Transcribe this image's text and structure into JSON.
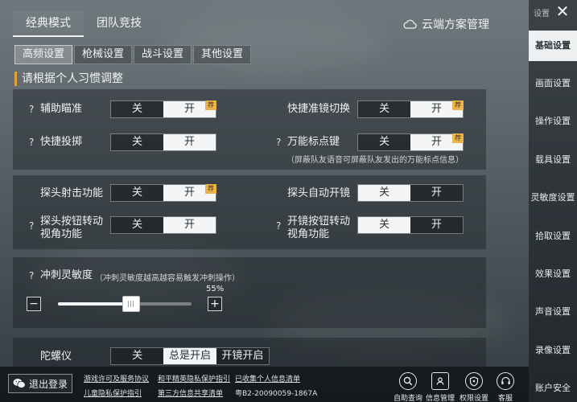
{
  "top_tabs": [
    {
      "label": "经典模式",
      "active": true
    },
    {
      "label": "团队竞技",
      "active": false
    }
  ],
  "cloud_manage": "云端方案管理",
  "sub_tabs": [
    {
      "label": "高频设置",
      "active": true
    },
    {
      "label": "枪械设置",
      "active": false
    },
    {
      "label": "战斗设置",
      "active": false
    },
    {
      "label": "其他设置",
      "active": false
    }
  ],
  "section_heading": "请根据个人习惯调整",
  "help_mark": "?",
  "toggle_off": "关",
  "toggle_on": "开",
  "badge_text": "荐",
  "panel1": {
    "aim_assist": {
      "label": "辅助瞄准",
      "selected": "on",
      "recommended": true
    },
    "quick_scope_switch": {
      "label": "快捷准镜切换",
      "selected": "on",
      "recommended": true
    },
    "quick_throw": {
      "label": "快捷投掷",
      "selected": "on",
      "recommended": false
    },
    "universal_marker": {
      "label": "万能标点键",
      "selected": "on",
      "recommended": true,
      "note": "（屏蔽队友语音可屏蔽队友发出的万能标点信息）"
    }
  },
  "panel2": {
    "peek_fire": {
      "label": "探头射击功能",
      "selected": "on",
      "recommended": true
    },
    "peek_auto_scope": {
      "label": "探头自动开镜",
      "selected": "off",
      "recommended": false
    },
    "peek_button_rotate": {
      "label_line1": "探头按钮转动",
      "label_line2": "视角功能",
      "selected": "on",
      "recommended": false
    },
    "scope_button_rotate": {
      "label_line1": "开镜按钮转动",
      "label_line2": "视角功能",
      "selected": "off",
      "recommended": false
    }
  },
  "panel3": {
    "label": "冲刺灵敏度",
    "note": "（冲刺灵敏度越高越容易触发冲刺操作）",
    "value": 0.55,
    "value_text": "55%",
    "minus": "−",
    "plus": "+"
  },
  "panel4": {
    "label": "陀螺仪",
    "options": [
      "关",
      "总是开启",
      "开镜开启"
    ],
    "selected_index": 1
  },
  "sidebar": {
    "title": "设置",
    "close": "✕",
    "items": [
      {
        "label": "基础设置",
        "active": true
      },
      {
        "label": "画面设置",
        "active": false
      },
      {
        "label": "操作设置",
        "active": false
      },
      {
        "label": "载具设置",
        "active": false
      },
      {
        "label": "灵敏度设置",
        "active": false
      },
      {
        "label": "拾取设置",
        "active": false
      },
      {
        "label": "效果设置",
        "active": false
      },
      {
        "label": "声音设置",
        "active": false
      },
      {
        "label": "录像设置",
        "active": false
      },
      {
        "label": "账户安全",
        "active": false
      }
    ]
  },
  "bottom": {
    "logout": "退出登录",
    "links": [
      "游戏许可及服务协议",
      "和平精英隐私保护指引",
      "已收集个人信息清单",
      "儿童隐私保护指引",
      "第三方信息共享清单",
      "粤B2-20090059-1867A"
    ],
    "icons": [
      {
        "label": "自助查询",
        "icon": "search-icon"
      },
      {
        "label": "信息管理",
        "icon": "id-card-icon"
      },
      {
        "label": "权限设置",
        "icon": "shield-icon"
      },
      {
        "label": "客服",
        "icon": "headset-icon"
      }
    ]
  }
}
